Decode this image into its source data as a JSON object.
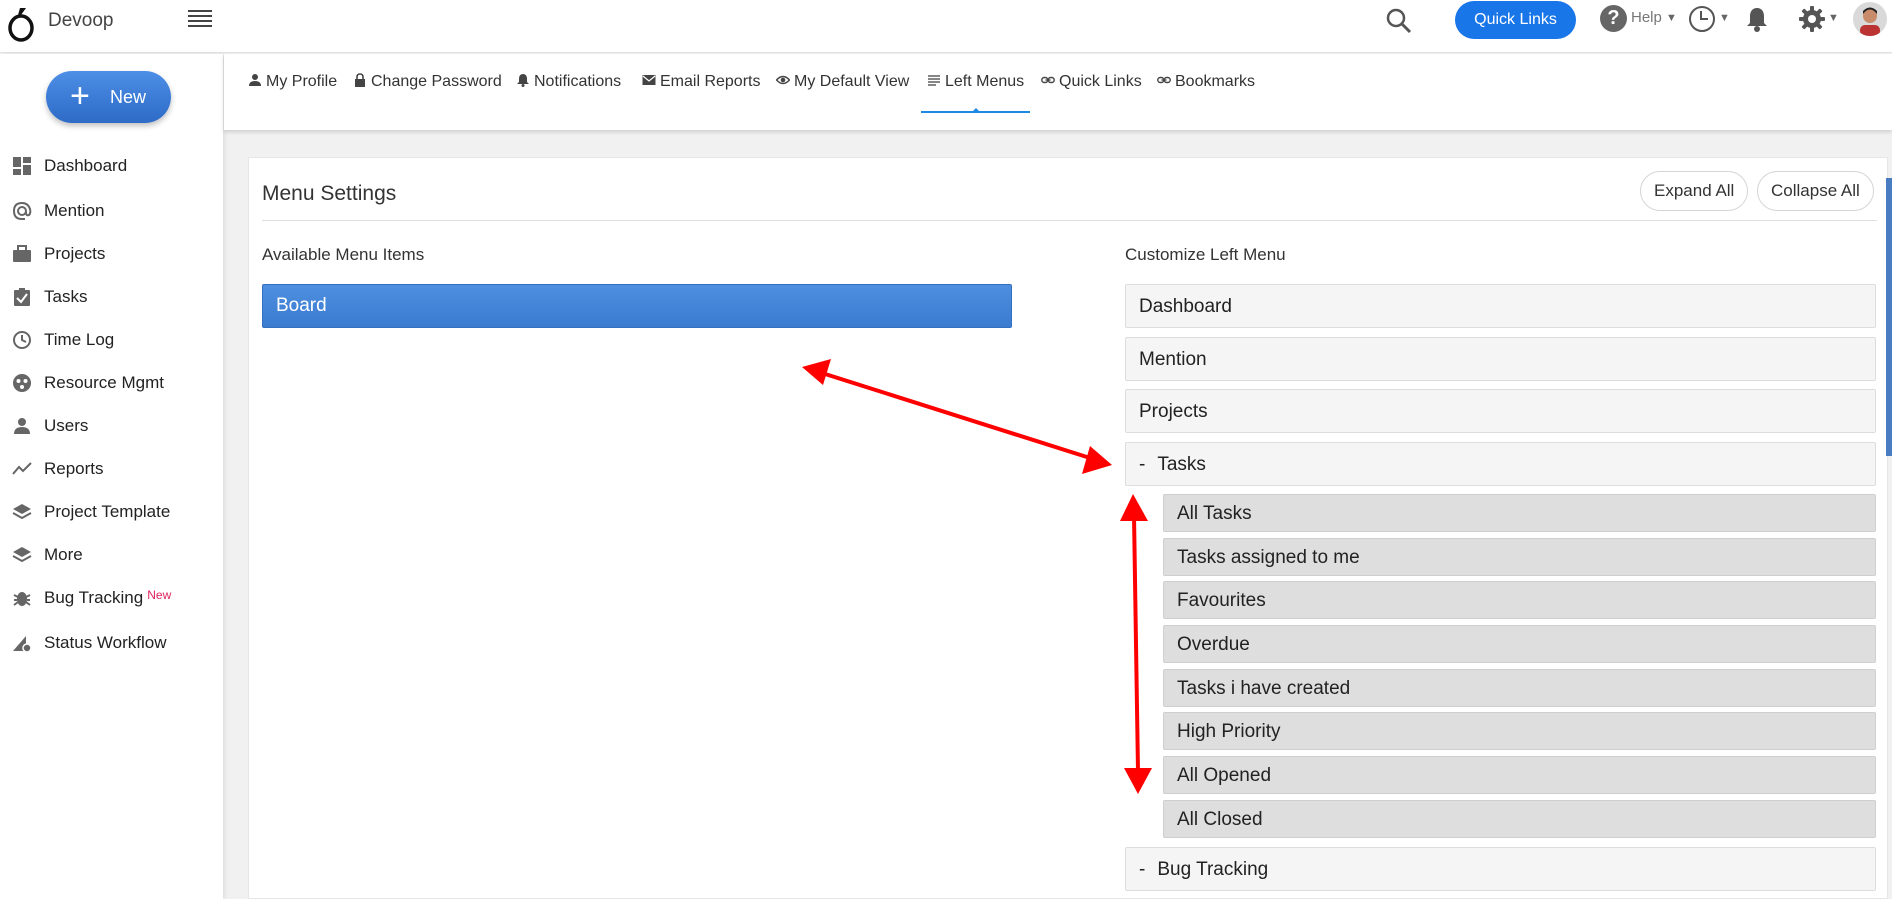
{
  "app": {
    "brand": "Devoop",
    "quick_links": "Quick Links",
    "help": "Help",
    "colors": {
      "primary": "#1976e8",
      "active_item": "#4a88dc",
      "annotation": "#ff0000",
      "new_badge": "#e0245e"
    }
  },
  "sidebar": {
    "new_label": "New",
    "items": [
      {
        "label": "Dashboard",
        "icon": "dashboard-icon"
      },
      {
        "label": "Mention",
        "icon": "at-icon"
      },
      {
        "label": "Projects",
        "icon": "briefcase-icon"
      },
      {
        "label": "Tasks",
        "icon": "clipboard-check-icon"
      },
      {
        "label": "Time Log",
        "icon": "clock-icon"
      },
      {
        "label": "Resource Mgmt",
        "icon": "resource-icon"
      },
      {
        "label": "Users",
        "icon": "user-icon"
      },
      {
        "label": "Reports",
        "icon": "trend-icon"
      },
      {
        "label": "Project Template",
        "icon": "layers-icon"
      },
      {
        "label": "More",
        "icon": "layers-icon"
      },
      {
        "label": "Bug Tracking",
        "icon": "bug-icon",
        "badge": "New"
      },
      {
        "label": "Status Workflow",
        "icon": "workflow-icon"
      }
    ]
  },
  "tabs": [
    {
      "label": "My Profile",
      "icon": "person-icon"
    },
    {
      "label": "Change Password",
      "icon": "lock-icon"
    },
    {
      "label": "Notifications",
      "icon": "bell-icon"
    },
    {
      "label": "Email Reports",
      "icon": "mail-icon"
    },
    {
      "label": "My Default View",
      "icon": "eye-icon"
    },
    {
      "label": "Left Menus",
      "icon": "list-icon",
      "active": true
    },
    {
      "label": "Quick Links",
      "icon": "link-icon"
    },
    {
      "label": "Bookmarks",
      "icon": "link-icon"
    }
  ],
  "menu_settings": {
    "title": "Menu Settings",
    "expand_all": "Expand All",
    "collapse_all": "Collapse All",
    "available_label": "Available Menu Items",
    "customize_label": "Customize Left Menu",
    "available_items": [
      "Board"
    ],
    "top_items": [
      "Dashboard",
      "Mention",
      "Projects"
    ],
    "tasks_group": {
      "toggle": "-",
      "label": "Tasks",
      "children": [
        "All Tasks",
        "Tasks assigned to me",
        "Favourites",
        "Overdue",
        "Tasks i have created",
        "High Priority",
        "All Opened",
        "All Closed"
      ]
    },
    "bug_group": {
      "toggle": "-",
      "label": "Bug Tracking"
    }
  }
}
